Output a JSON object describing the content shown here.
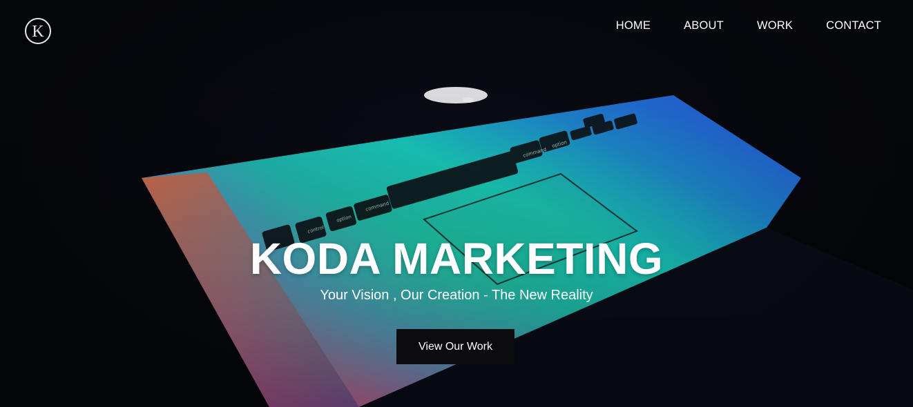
{
  "logo": {
    "letter": "K"
  },
  "nav": {
    "items": [
      {
        "label": "HOME"
      },
      {
        "label": "ABOUT"
      },
      {
        "label": "WORK"
      },
      {
        "label": "CONTACT"
      }
    ]
  },
  "hero": {
    "title": "KODA MARKETING",
    "subtitle": "Your Vision , Our Creation - The New Reality",
    "cta_label": "View Our Work"
  },
  "keys": {
    "control": "control",
    "option": "option",
    "command": "command"
  },
  "colors": {
    "background": "#07080d",
    "button_bg": "#0c0c0f",
    "text": "#ffffff"
  }
}
